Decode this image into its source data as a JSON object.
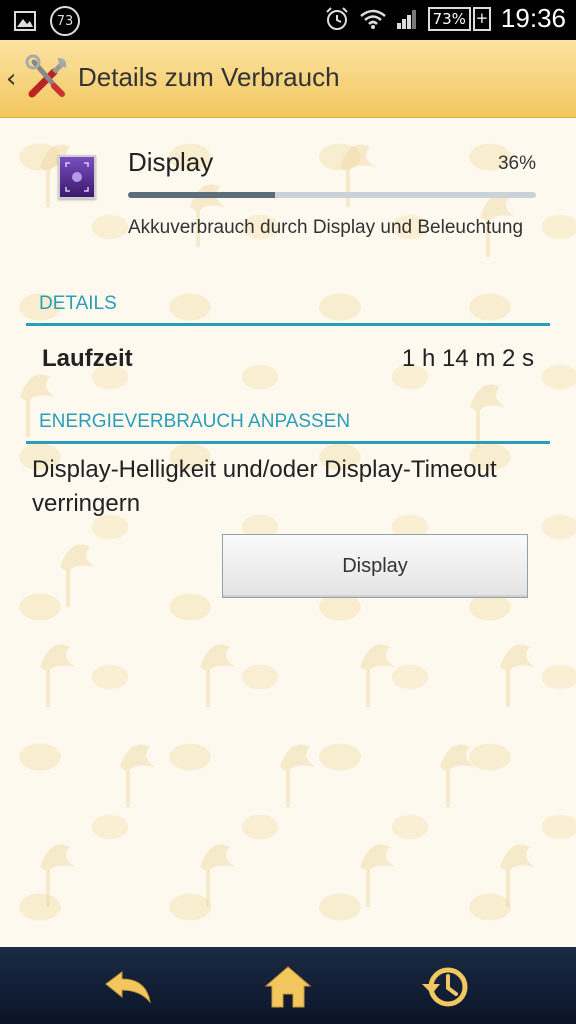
{
  "status_bar": {
    "notification_count": "73",
    "battery_percent": "73%",
    "battery_plus": "+",
    "time": "19:36",
    "icons": [
      "image-icon",
      "alarm-icon",
      "wifi-icon",
      "signal-icon",
      "battery-icon"
    ]
  },
  "header": {
    "back_glyph": "‹",
    "title": "Details zum Verbrauch",
    "icon": "tools-icon"
  },
  "usage": {
    "app_name": "Display",
    "percent_text": "36%",
    "percent_value": 0.36,
    "description": "Akkuverbrauch durch Display und Beleuchtung",
    "icon": "display-icon"
  },
  "sections": {
    "details": "DETAILS",
    "adjust": "ENERGIEVERBRAUCH ANPASSEN"
  },
  "runtime": {
    "label": "Laufzeit",
    "value": "1 h 14 m 2 s"
  },
  "tip": {
    "text": "Display-Helligkeit und/oder Display-Timeout verringern",
    "button_label": "Display"
  },
  "nav": {
    "items": [
      "back-icon",
      "home-icon",
      "history-icon"
    ]
  },
  "colors": {
    "accent": "#2a9dbb",
    "header_bg": "#f2c75f",
    "nav_bg": "#0a1528",
    "nav_icon": "#f2c75f"
  }
}
